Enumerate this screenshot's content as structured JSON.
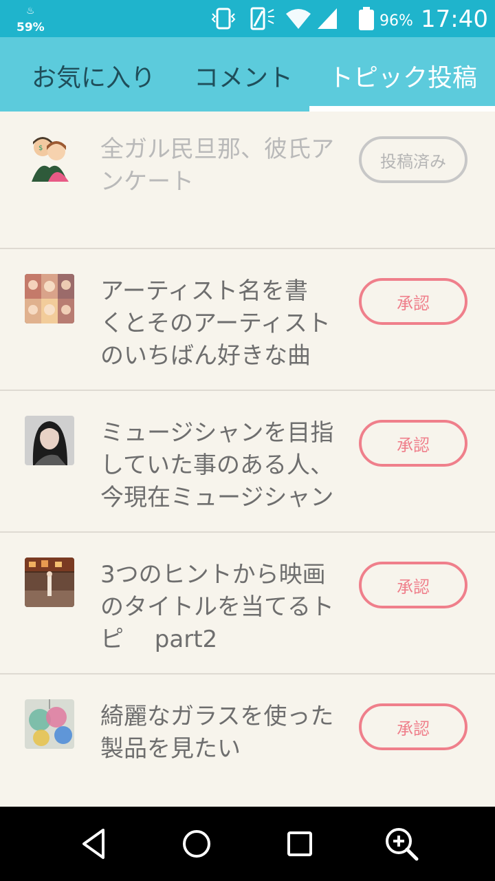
{
  "statusbar": {
    "left_pct": "59%",
    "battery_pct": "96%",
    "time": "17:40",
    "icons": [
      "usb-icon",
      "vibrate-icon",
      "wifi-icon",
      "signal-icon",
      "battery-icon"
    ]
  },
  "tabs": [
    {
      "label": "お気に入り",
      "active": false
    },
    {
      "label": "コメント",
      "active": false
    },
    {
      "label": "トピック投稿",
      "active": true
    }
  ],
  "items": [
    {
      "title_lines": [
        "全ガル民旦那、彼氏ア",
        "ンケート"
      ],
      "button": "投稿済み",
      "status": "posted"
    },
    {
      "title_lines": [
        "アーティスト名を書",
        "くとそのアーティスト",
        "のいちばん好きな曲"
      ],
      "button": "承認",
      "status": "pending"
    },
    {
      "title_lines": [
        "ミュージシャンを目指",
        "していた事のある人、",
        "今現在ミュージシャン"
      ],
      "button": "承認",
      "status": "pending"
    },
    {
      "title_lines": [
        "3つのヒントから映画",
        "のタイトルを当てるト",
        "ピ　 part2"
      ],
      "button": "承認",
      "status": "pending"
    },
    {
      "title_lines": [
        "綺麗なガラスを使った",
        "製品を見たい"
      ],
      "button": "承認",
      "status": "pending"
    }
  ],
  "colors": {
    "statusbar": "#1fb4cc",
    "tabbar": "#5ccbdc",
    "background": "#f7f4ec",
    "approve": "#ef7f8b",
    "posted": "#c7c7c7"
  },
  "navbar": [
    "back-icon",
    "home-icon",
    "recents-icon",
    "zoom-icon"
  ]
}
